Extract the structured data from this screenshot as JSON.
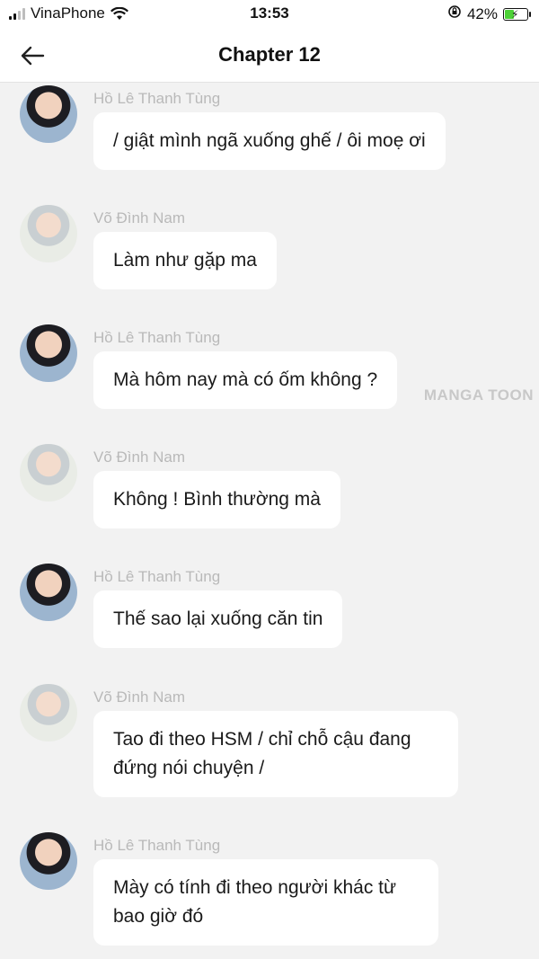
{
  "status_bar": {
    "carrier": "VinaPhone",
    "time": "13:53",
    "battery_percent": "42%",
    "battery_level": 0.42
  },
  "nav": {
    "title": "Chapter 12",
    "back_icon": "arrow-left-icon"
  },
  "watermark": "MANGA TOON",
  "messages": [
    {
      "sender": "Hồ Lê Thanh Tùng",
      "avatar": "tung",
      "text": "/ giật mình ngã xuống ghế / ôi moẹ ơi"
    },
    {
      "sender": "Võ Đình Nam",
      "avatar": "nam",
      "text": "Làm như gặp ma"
    },
    {
      "sender": "Hồ Lê Thanh Tùng",
      "avatar": "tung",
      "text": "Mà hôm nay mà có ốm không ?"
    },
    {
      "sender": "Võ Đình Nam",
      "avatar": "nam",
      "text": "Không ! Bình thường mà"
    },
    {
      "sender": "Hồ Lê Thanh Tùng",
      "avatar": "tung",
      "text": "Thế sao lại xuống căn tin"
    },
    {
      "sender": "Võ Đình Nam",
      "avatar": "nam",
      "text": "Tao đi theo HSM / chỉ chỗ cậu đang đứng nói chuyện /"
    },
    {
      "sender": "Hồ Lê Thanh Tùng",
      "avatar": "tung",
      "text": "Mày có tính đi theo người khác từ bao giờ đó"
    }
  ]
}
